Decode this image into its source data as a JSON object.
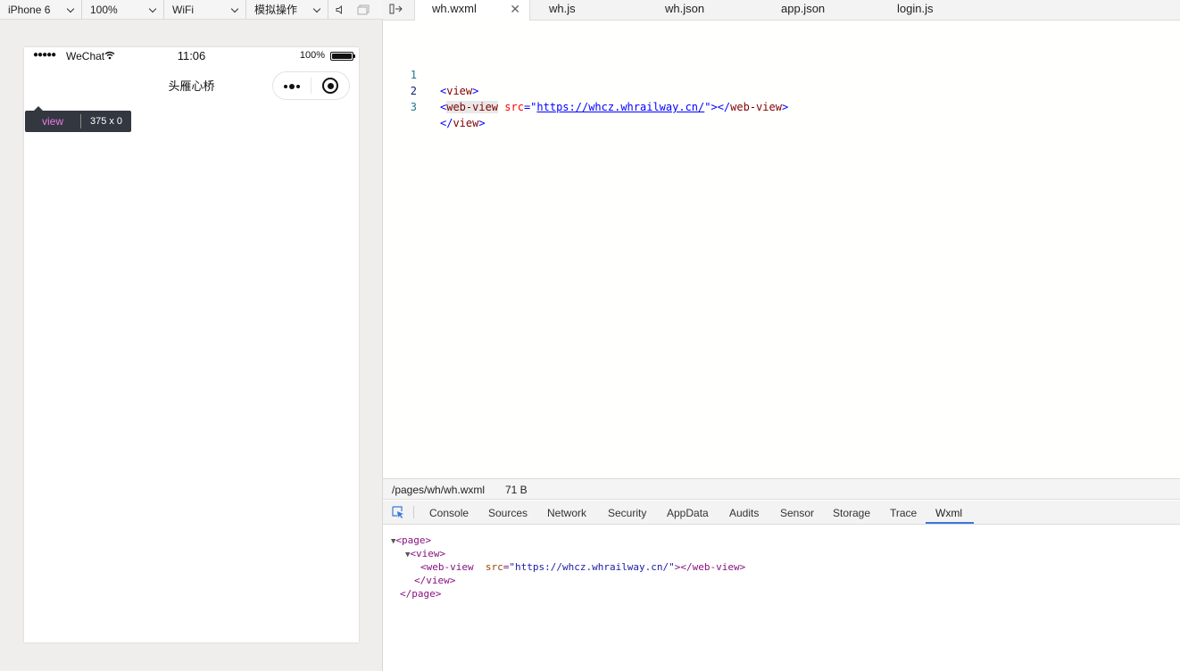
{
  "simulator": {
    "toolbar": {
      "device": "iPhone 6",
      "zoom": "100%",
      "network": "WiFi",
      "operations": "模拟操作"
    },
    "status_bar": {
      "signal": "●●●●●",
      "carrier": "WeChat",
      "time": "11:06",
      "battery_pct": "100%",
      "battery_level": 1.0
    },
    "nav_bar": {
      "title": "头雁心桥"
    },
    "inspect_tooltip": {
      "tag": "view",
      "size": "375 x 0"
    }
  },
  "editor": {
    "tabs": [
      {
        "label": "wh.wxml",
        "active": true
      },
      {
        "label": "wh.js",
        "active": false
      },
      {
        "label": "wh.json",
        "active": false
      },
      {
        "label": "app.json",
        "active": false
      },
      {
        "label": "login.js",
        "active": false
      }
    ],
    "close_glyph": "✕",
    "lines": [
      {
        "num": "1",
        "p1": "<",
        "tag": "view",
        "p2": ">"
      },
      {
        "num": "2",
        "p1": "<",
        "tag": "web-view",
        "attr": "src",
        "eq": "=\"",
        "url": "https://whcz.whrailway.cn/",
        "p2": "\"></",
        "tag2": "web-view",
        "p3": ">"
      },
      {
        "num": "3",
        "p1": "</",
        "tag": "view",
        "p2": ">"
      }
    ],
    "status": {
      "path": "/pages/wh/wh.wxml",
      "size": "71 B"
    }
  },
  "devtools": {
    "tabs": [
      "Console",
      "Sources",
      "Network",
      "Security",
      "AppData",
      "Audits",
      "Sensor",
      "Storage",
      "Trace",
      "Wxml"
    ],
    "active_tab": "Wxml",
    "tree": {
      "page_open": "<page>",
      "view_open": "<view>",
      "webview_open": "<web-view",
      "webview_attr": "src",
      "webview_val": "\"https://whcz.whrailway.cn/\"",
      "webview_close": "></web-view>",
      "view_close": "</view>",
      "page_close": "</page>",
      "triangle": "▼"
    }
  }
}
